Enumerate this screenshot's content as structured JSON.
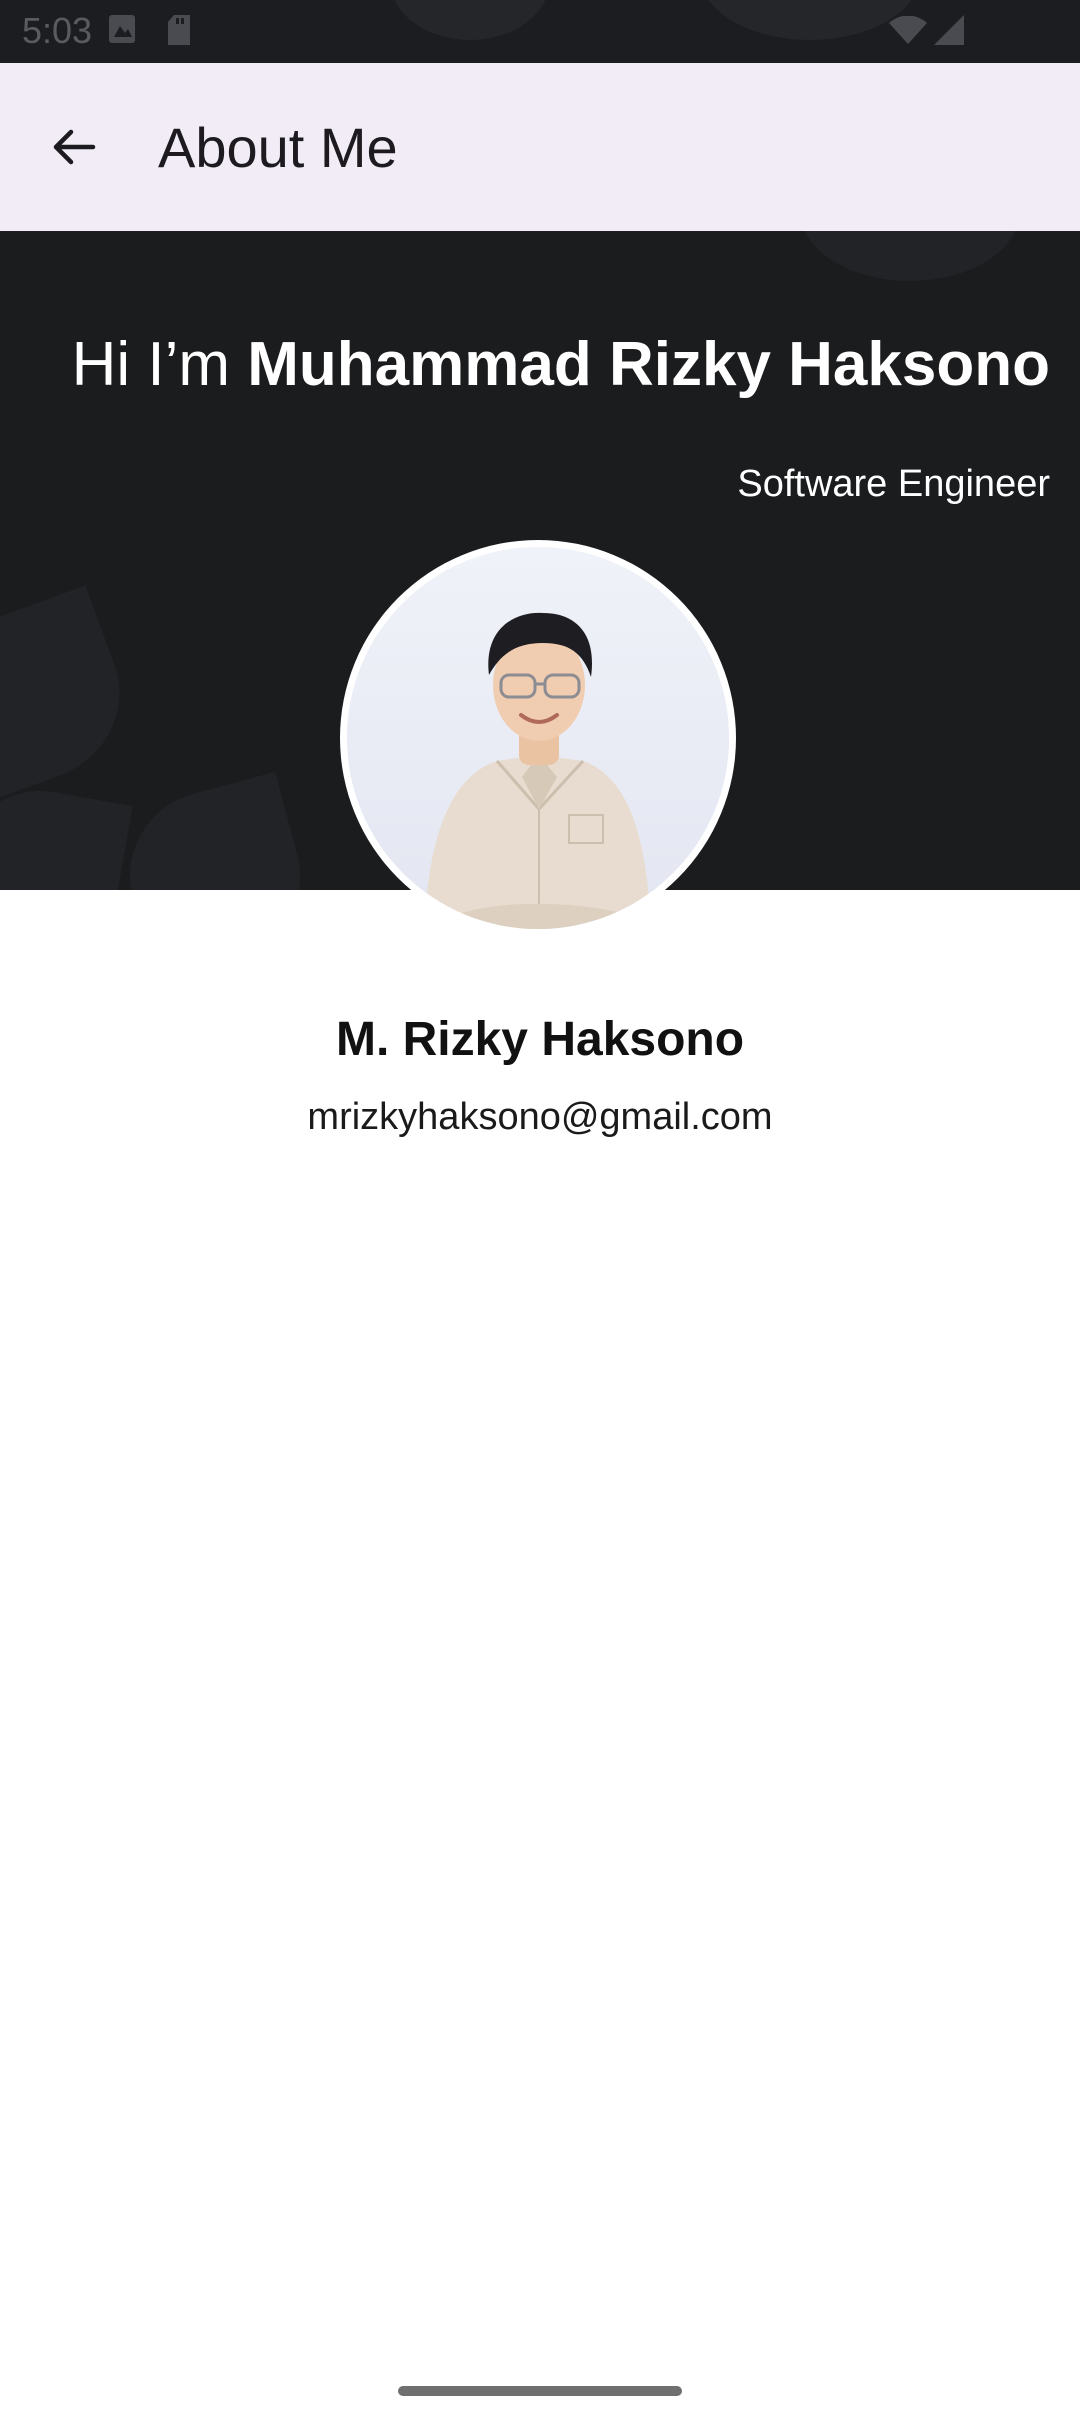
{
  "status_bar": {
    "time": "5:03",
    "icons": [
      "image-icon",
      "sd-card-icon",
      "wifi-icon",
      "signal-icon"
    ]
  },
  "app_bar": {
    "back_icon": "arrow-left-icon",
    "title": "About Me"
  },
  "hero": {
    "greeting_prefix": "Hi I’m ",
    "full_name": "Muhammad Rizky Haksono",
    "role": "Software Engineer",
    "background_color": "#1b1c1e"
  },
  "profile": {
    "avatar": "profile-photo",
    "name": "M. Rizky Haksono",
    "email": "mrizkyhaksono@gmail.com"
  },
  "colors": {
    "app_bar_bg": "#f1ecf6",
    "hero_bg": "#1b1c1e",
    "text_dark": "#1d1b20"
  }
}
